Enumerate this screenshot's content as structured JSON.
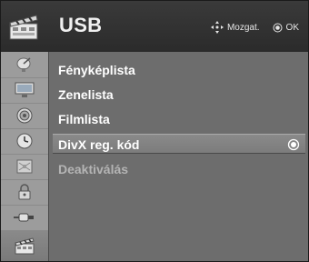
{
  "header": {
    "title": "USB",
    "icon": "usb-clapperboard-icon",
    "hint_move_icon": "dpad-arrows-icon",
    "hint_move_label": "Mozgat.",
    "hint_ok_icon": "ok-circle-icon",
    "hint_ok_label": "OK"
  },
  "rail": {
    "items": [
      {
        "icon": "satellite-dish-icon"
      },
      {
        "icon": "monitor-icon"
      },
      {
        "icon": "speaker-icon"
      },
      {
        "icon": "clock-icon"
      },
      {
        "icon": "abstract-option-icon"
      },
      {
        "icon": "lock-icon"
      },
      {
        "icon": "connector-plug-icon"
      },
      {
        "icon": "usb-clapperboard-icon",
        "active": true
      }
    ]
  },
  "menu": {
    "items": [
      {
        "label": "Fényképlista",
        "state": "normal"
      },
      {
        "label": "Zenelista",
        "state": "normal"
      },
      {
        "label": "Filmlista",
        "state": "normal"
      },
      {
        "label": "DivX reg. kód",
        "state": "selected"
      },
      {
        "label": "Deaktiválás",
        "state": "disabled"
      }
    ]
  },
  "colors": {
    "header_bg": "#2e2e2e",
    "rail_bg": "#9c9c9c",
    "main_bg": "#6d6d6d",
    "selected_bg": "#828282",
    "text": "#ffffff",
    "text_disabled": "#b4b4b4"
  }
}
